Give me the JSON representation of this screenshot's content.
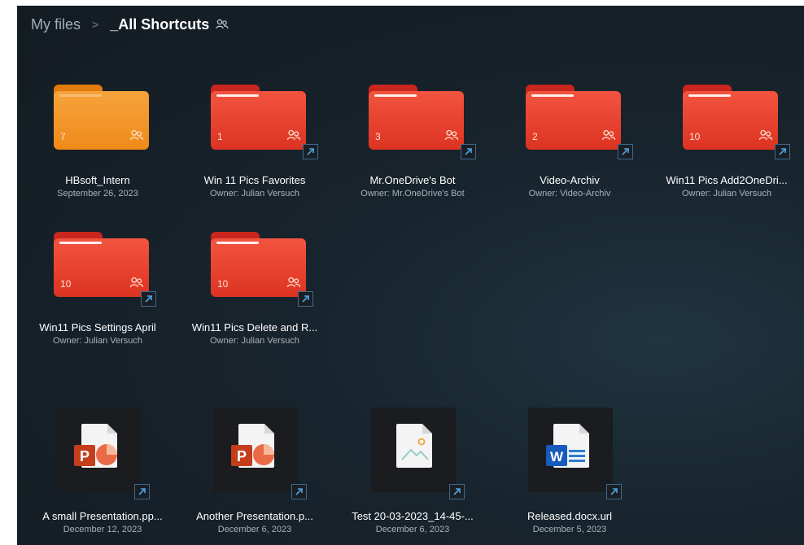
{
  "breadcrumb": {
    "root": "My files",
    "separator": ">",
    "current": "_All Shortcuts"
  },
  "folders": [
    {
      "name": "HBsoft_Intern",
      "sub": "September 26, 2023",
      "count": "7",
      "color": "#f39a2c",
      "shortcut": false
    },
    {
      "name": "Win 11 Pics Favorites",
      "sub": "Owner: Julian Versuch",
      "count": "1",
      "color": "#e8412c",
      "shortcut": true
    },
    {
      "name": "Mr.OneDrive's Bot",
      "sub": "Owner: Mr.OneDrive's Bot",
      "count": "3",
      "color": "#e8412c",
      "shortcut": true
    },
    {
      "name": "Video-Archiv",
      "sub": "Owner: Video-Archiv",
      "count": "2",
      "color": "#e8412c",
      "shortcut": true
    },
    {
      "name": "Win11 Pics Add2OneDri...",
      "sub": "Owner: Julian Versuch",
      "count": "10",
      "color": "#e8412c",
      "shortcut": true
    },
    {
      "name": "Win11 Pics Settings April",
      "sub": "Owner: Julian Versuch",
      "count": "10",
      "color": "#e8412c",
      "shortcut": true
    },
    {
      "name": "Win11 Pics Delete and R...",
      "sub": "Owner: Julian Versuch",
      "count": "10",
      "color": "#e8412c",
      "shortcut": true
    }
  ],
  "files": [
    {
      "name": "A small Presentation.pp...",
      "sub": "December 12, 2023",
      "type": "powerpoint",
      "letter": "P"
    },
    {
      "name": "Another Presentation.p...",
      "sub": "December 6, 2023",
      "type": "powerpoint",
      "letter": "P"
    },
    {
      "name": "Test 20-03-2023_14-45-...",
      "sub": "December 6, 2023",
      "type": "image",
      "letter": ""
    },
    {
      "name": "Released.docx.url",
      "sub": "December 5, 2023",
      "type": "word",
      "letter": "W"
    }
  ]
}
